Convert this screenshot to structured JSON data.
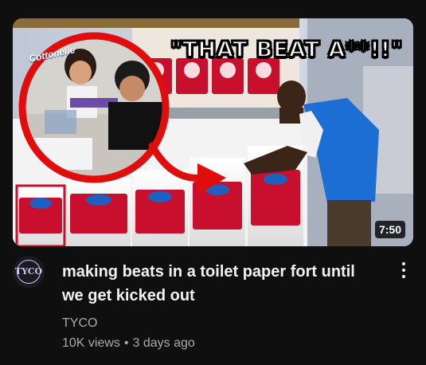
{
  "video": {
    "thumbnail": {
      "overlay_caption": "\"THAT BEAT A**!!\"",
      "brand_text": "Cottonelle",
      "duration": "7:50"
    },
    "title": "making beats in a toilet paper fort until we get kicked out",
    "channel": {
      "name": "TYCO",
      "avatar_text": "TYCO"
    },
    "views": "10K views",
    "separator": "•",
    "age": "3 days ago"
  },
  "colors": {
    "background": "#0f0f0f",
    "title": "#f1f1f1",
    "secondary_text": "#aaaaaa",
    "circle_red": "#e10d0d",
    "arrow_red": "#e10d0d"
  },
  "icons": {
    "menu": "more-vert-icon",
    "arrow": "curved-arrow-icon"
  }
}
